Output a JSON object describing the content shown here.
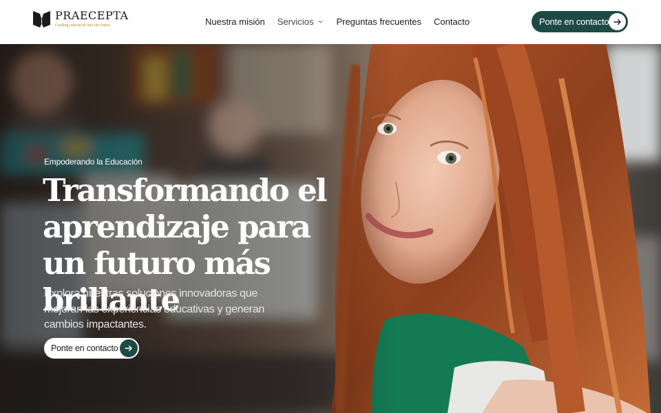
{
  "brand": {
    "name": "PRAECEPTA",
    "tagline": "Guiding education into the future",
    "logo_icon": "book-icon",
    "colors": {
      "primary": "#1e4a45",
      "gold": "#b98b2e"
    }
  },
  "nav": {
    "items": [
      {
        "label": "Nuestra misión"
      },
      {
        "label": "Servicios",
        "icon": "chevron-down-icon"
      },
      {
        "label": "Preguntas frecuentes"
      },
      {
        "label": "Contacto"
      }
    ]
  },
  "header_cta": {
    "label": "Ponte en contacto",
    "icon": "arrow-right-icon"
  },
  "hero": {
    "eyebrow": "Empoderando la Educación",
    "headline": "Transformando el aprendizaje para un futuro más brillante",
    "subtext": "Explora nuestras soluciones innovadoras que mejoran las experiencias educativas y generan cambios impactantes.",
    "cta": {
      "label": "Ponte en contacto",
      "icon": "arrow-right-icon"
    },
    "image": "photo of smiling red-haired girl in classroom"
  }
}
